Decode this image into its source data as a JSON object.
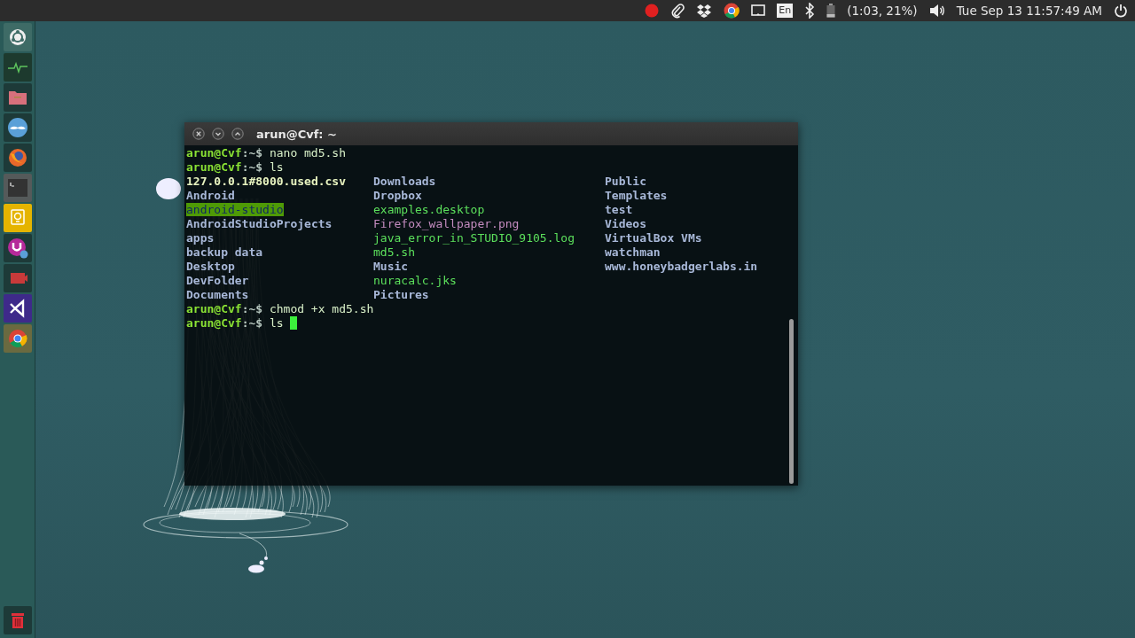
{
  "top_bar": {
    "keyboard_layout": "En",
    "battery": "(1:03, 21%)",
    "clock": "Tue Sep 13 11:57:49 AM"
  },
  "terminal": {
    "title": "arun@Cvf: ~",
    "lines": [
      {
        "kind": "prompt",
        "user": "arun@Cvf",
        "path": ":~$",
        "command": "nano md5.sh",
        "cursor": false
      },
      {
        "kind": "prompt",
        "user": "arun@Cvf",
        "path": ":~$",
        "command": "ls",
        "cursor": false
      },
      {
        "kind": "listing",
        "columns": [
          [
            {
              "name": "127.0.0.1#8000.used.csv",
              "kind": "plain"
            },
            {
              "name": "Android",
              "kind": "dir"
            },
            {
              "name": "android-studio",
              "kind": "shared"
            },
            {
              "name": "AndroidStudioProjects",
              "kind": "dir"
            },
            {
              "name": "apps",
              "kind": "dir"
            },
            {
              "name": "backup data",
              "kind": "dir"
            },
            {
              "name": "Desktop",
              "kind": "dir"
            },
            {
              "name": "DevFolder",
              "kind": "dir"
            },
            {
              "name": "Documents",
              "kind": "dir"
            }
          ],
          [
            {
              "name": "Downloads",
              "kind": "dir"
            },
            {
              "name": "Dropbox",
              "kind": "dir"
            },
            {
              "name": "examples.desktop",
              "kind": "exec"
            },
            {
              "name": "Firefox_wallpaper.png",
              "kind": "image"
            },
            {
              "name": "java_error_in_STUDIO_9105.log",
              "kind": "exec"
            },
            {
              "name": "md5.sh",
              "kind": "exec"
            },
            {
              "name": "Music",
              "kind": "dir"
            },
            {
              "name": "nuracalc.jks",
              "kind": "exec"
            },
            {
              "name": "Pictures",
              "kind": "dir"
            }
          ],
          [
            {
              "name": "Public",
              "kind": "dir"
            },
            {
              "name": "Templates",
              "kind": "dir"
            },
            {
              "name": "test",
              "kind": "dir"
            },
            {
              "name": "Videos",
              "kind": "dir"
            },
            {
              "name": "VirtualBox VMs",
              "kind": "dir"
            },
            {
              "name": "watchman",
              "kind": "dir"
            },
            {
              "name": "www.honeybadgerlabs.in",
              "kind": "dir"
            }
          ]
        ]
      },
      {
        "kind": "prompt",
        "user": "arun@Cvf",
        "path": ":~$",
        "command": "chmod +x md5.sh",
        "cursor": false
      },
      {
        "kind": "prompt",
        "user": "arun@Cvf",
        "path": ":~$",
        "command": "ls ",
        "cursor": true
      }
    ]
  }
}
